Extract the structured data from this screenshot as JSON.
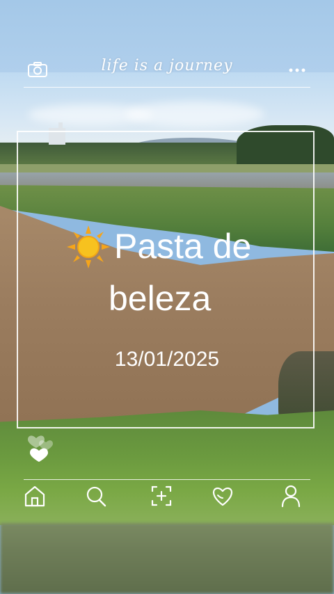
{
  "header": {
    "title": "life is a journey",
    "left_icon": "camera-icon",
    "right_icon": "more-dots-icon"
  },
  "card": {
    "emoji_icon": "sun-icon",
    "heading_line1": "Pasta de",
    "heading_line2": "beleza",
    "date": "13/01/2025"
  },
  "decor": {
    "hearts_icon": "hearts-icon"
  },
  "nav": {
    "items": [
      {
        "icon": "home-icon"
      },
      {
        "icon": "search-icon"
      },
      {
        "icon": "add-frame-icon"
      },
      {
        "icon": "heart-icon"
      },
      {
        "icon": "profile-icon"
      }
    ]
  },
  "colors": {
    "overlay": "#ffffff",
    "sun": "#f5b21b"
  }
}
